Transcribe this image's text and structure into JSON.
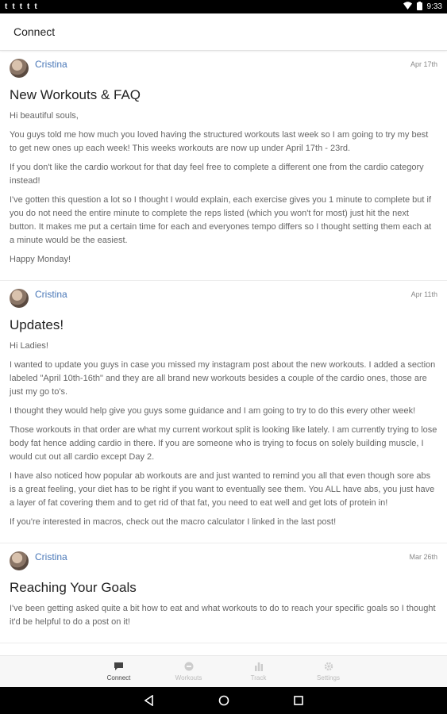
{
  "status_bar": {
    "left_icons": [
      "t",
      "t",
      "t",
      "t",
      "t"
    ],
    "time": "9:33"
  },
  "app_bar": {
    "title": "Connect"
  },
  "posts": [
    {
      "author": "Cristina",
      "date": "Apr 17th",
      "title": "New Workouts & FAQ",
      "paragraphs": [
        "Hi beautiful souls,",
        "You guys told me how much you loved having the structured workouts last week so I am going to try my best to get new ones up each week! This weeks workouts are now up under April 17th - 23rd.",
        "If you don't like the cardio workout for that day feel free to complete a different one from the cardio category instead!",
        "I've gotten this question a lot so I thought I would explain, each exercise gives you 1 minute to complete but if you do not need the entire minute to complete the reps listed (which you won't for most) just hit the next button. It makes me put a certain time for each and everyones tempo differs so I thought setting them each at a minute would be the easiest.",
        "Happy Monday!"
      ]
    },
    {
      "author": "Cristina",
      "date": "Apr 11th",
      "title": "Updates!",
      "paragraphs": [
        "Hi Ladies!",
        "I wanted to update you guys in case you missed my instagram post about the new workouts. I added a section labeled \"April 10th-16th\" and they are all brand new workouts besides a couple of the cardio ones, those are just my go to's.",
        "I thought they would help give you guys some guidance and I am going to try to do this every other week!",
        "Those workouts in that order are what my current workout split is looking like lately. I am currently trying to lose body fat hence adding cardio in there. If you are someone who is trying to focus on solely building muscle, I would cut out all cardio except Day 2.",
        "I have also noticed how popular ab workouts are and just wanted to remind you all that even though sore abs is a great feeling, your diet has to be right if you want to eventually see them. You ALL have abs, you just have a layer of fat covering them and to get rid of that fat, you need to eat well and get lots of protein in!",
        "If you're interested in macros, check out the macro calculator I linked in the last post!"
      ]
    },
    {
      "author": "Cristina",
      "date": "Mar 26th",
      "title": "Reaching Your Goals",
      "paragraphs": [
        "I've been getting asked quite a bit how to eat and what workouts to do to reach your specific goals so I thought it'd be helpful to do a post on it!"
      ]
    }
  ],
  "bottom_nav": [
    {
      "label": "Connect",
      "icon": "chat-bubble-icon",
      "active": true
    },
    {
      "label": "Workouts",
      "icon": "dumbbell-icon",
      "active": false
    },
    {
      "label": "Track",
      "icon": "bar-chart-icon",
      "active": false
    },
    {
      "label": "Settings",
      "icon": "gear-icon",
      "active": false
    }
  ],
  "colors": {
    "author_link": "#4a78b8",
    "active_nav": "#444444",
    "inactive_nav": "#bbbbbb"
  }
}
